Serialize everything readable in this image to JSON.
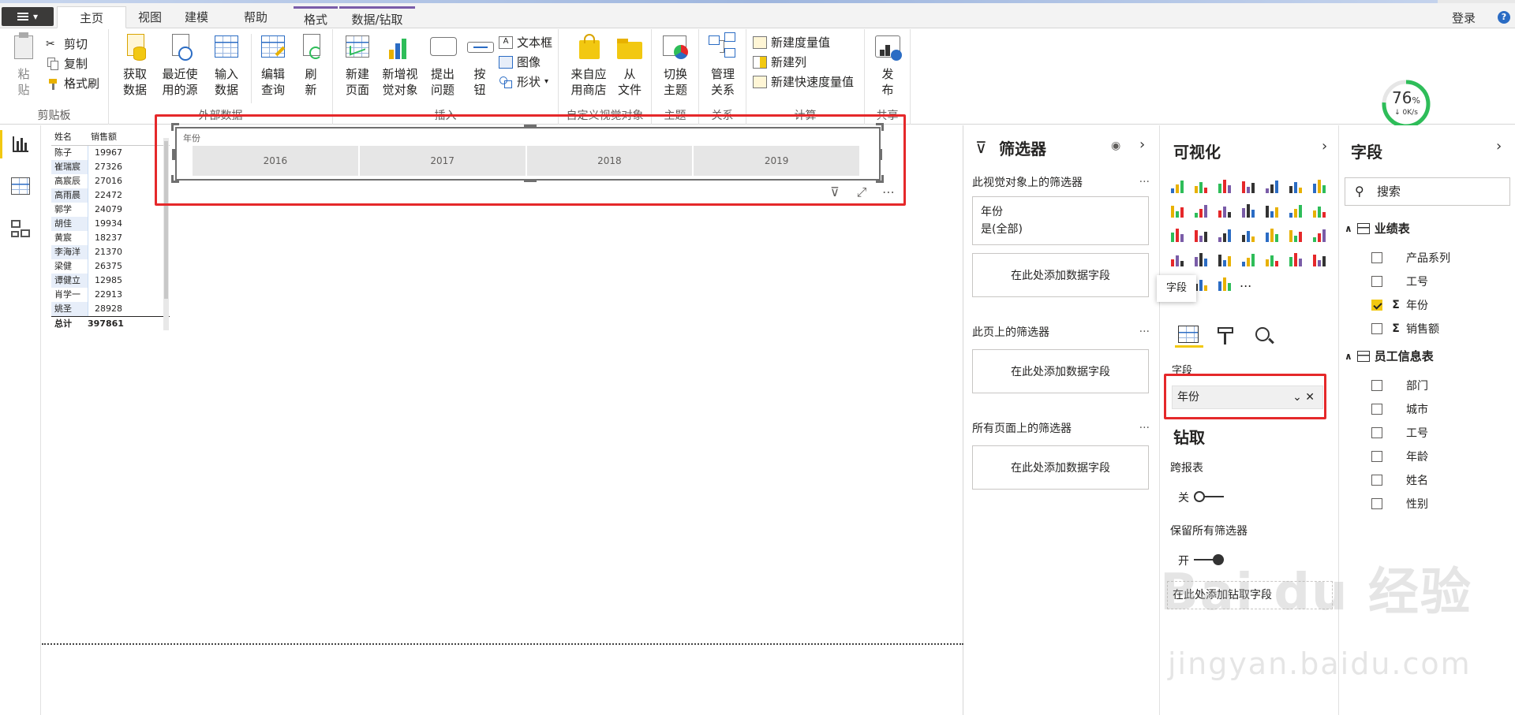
{
  "ribbon_tabs": [
    "主页",
    "视图",
    "建模",
    "帮助",
    "格式",
    "数据/钻取"
  ],
  "login": "登录",
  "help": "?",
  "clipboard": {
    "paste": "粘\n贴",
    "cut": "剪切",
    "copy": "复制",
    "format_painter": "格式刷",
    "label": "剪贴板"
  },
  "external_data": {
    "get_data": "获取\n数据",
    "recent_sources": "最近使\n用的源",
    "enter_data": "输入\n数据",
    "edit_queries": "编辑\n查询",
    "refresh": "刷\n新",
    "label": "外部数据"
  },
  "insert": {
    "new_page": "新建\n页面",
    "new_visual": "新增视\n觉对象",
    "ask_question": "提出\n问题",
    "buttons": "按\n钮",
    "textbox": "文本框",
    "image": "图像",
    "shapes": "形状",
    "label": "插入"
  },
  "custom_visuals": {
    "from_store": "来自应\n用商店",
    "from_file": "从\n文件",
    "label": "自定义视觉对象"
  },
  "themes": {
    "switch": "切换\n主题",
    "label": "主题"
  },
  "relationships": {
    "manage": "管理\n关系",
    "label": "关系"
  },
  "calculations": {
    "new_measure": "新建度量值",
    "new_column": "新建列",
    "new_quick_measure": "新建快速度量值",
    "label": "计算"
  },
  "share": {
    "publish": "发\n布",
    "label": "共享"
  },
  "network_gauge": {
    "percent": "76",
    "percent_sign": "%",
    "speed": "0K/s",
    "value": 0.76
  },
  "table_visual": {
    "headers": [
      "姓名",
      "销售额"
    ],
    "rows": [
      [
        "陈子",
        "19967"
      ],
      [
        "崔瑞宸",
        "27326"
      ],
      [
        "高宸辰",
        "27016"
      ],
      [
        "高雨晨",
        "22472"
      ],
      [
        "郭学",
        "24079"
      ],
      [
        "胡佳",
        "19934"
      ],
      [
        "黄宸",
        "18237"
      ],
      [
        "李海洋",
        "21370"
      ],
      [
        "梁健",
        "26375"
      ],
      [
        "谭健立",
        "12985"
      ],
      [
        "肖学一",
        "22913"
      ],
      [
        "姚圣",
        "28928"
      ]
    ],
    "total_label": "总计",
    "total_value": "397861"
  },
  "slicer": {
    "title": "年份",
    "years": [
      "2016",
      "2017",
      "2018",
      "2019"
    ]
  },
  "filters_pane": {
    "title": "筛选器",
    "visual_section": "此视觉对象上的筛选器",
    "visual_card_field": "年份",
    "visual_card_value": "是(全部)",
    "add_field": "在此处添加数据字段",
    "page_section": "此页上的筛选器",
    "all_pages_section": "所有页面上的筛选器",
    "more": "..."
  },
  "viz_pane": {
    "title": "可视化",
    "tooltip": "字段",
    "fields_label": "字段",
    "field_well_value": "年份",
    "drill_title": "钻取",
    "cross_report": "跨报表",
    "off": "关",
    "keep_filters": "保留所有筛选器",
    "on": "开",
    "add_drill": "在此处添加钻取字段",
    "more": "..."
  },
  "fields_pane": {
    "title": "字段",
    "search_placeholder": "搜索",
    "tables": [
      {
        "name": "业绩表",
        "fields": [
          {
            "name": "产品系列",
            "sigma": "",
            "checked": false
          },
          {
            "name": "工号",
            "sigma": "",
            "checked": false
          },
          {
            "name": "年份",
            "sigma": "Σ",
            "checked": true
          },
          {
            "name": "销售额",
            "sigma": "Σ",
            "checked": false
          }
        ]
      },
      {
        "name": "员工信息表",
        "fields": [
          {
            "name": "部门",
            "sigma": "",
            "checked": false
          },
          {
            "name": "城市",
            "sigma": "",
            "checked": false
          },
          {
            "name": "工号",
            "sigma": "",
            "checked": false
          },
          {
            "name": "年龄",
            "sigma": "",
            "checked": false
          },
          {
            "name": "姓名",
            "sigma": "",
            "checked": false
          },
          {
            "name": "性别",
            "sigma": "",
            "checked": false
          }
        ]
      }
    ]
  },
  "watermark": {
    "brand": "Bai du 经验",
    "url": "jingyan.baidu.com"
  },
  "colors": {
    "accent": "#f2c811",
    "highlight": "#e5282a",
    "gauge": "#2ebd59"
  }
}
